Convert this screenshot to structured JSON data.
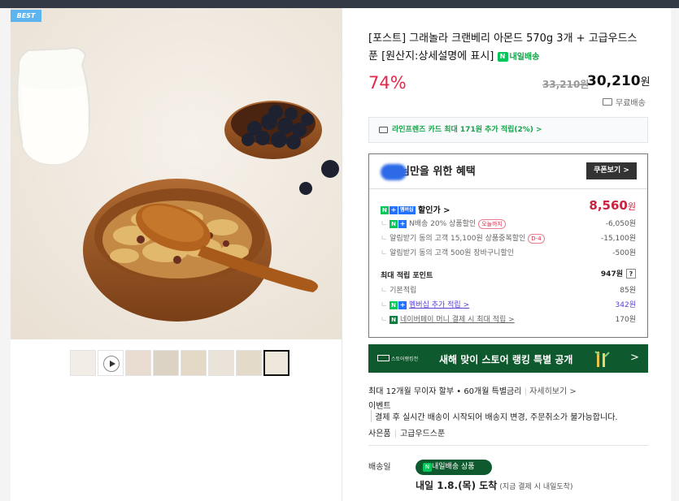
{
  "gallery": {
    "badge": "BEST",
    "thumb_count": 8
  },
  "product": {
    "title": "[포스트] 그래놀라 크랜베리 아몬드 570g 3개 + 고급우드스푼 [원산지:상세설명에 표시]",
    "nextday_label": "내일배송",
    "discount": "74%",
    "original_price": "33,210원",
    "price": "30,210",
    "price_unit": "원",
    "shipping": "무료배송",
    "card_benefit": "라인프렌즈 카드 최대 171원 추가 적립(2%) >"
  },
  "benefit": {
    "title": "님만을 위한 혜택",
    "coupon_button": "쿠폰보기 >",
    "discount_label": "할인가 >",
    "discount_price": "8,560",
    "discount_unit": "원",
    "items": [
      {
        "label": "N배송 20% 상품할인",
        "tag": "오늘까지",
        "amount": "-6,050원"
      },
      {
        "label": "알림받기 동의 고객 15,100원 상품중복할인",
        "tag": "D-4",
        "amount": "-15,100원"
      },
      {
        "label": "알림받기 동의 고객 500원 장바구니할인",
        "tag": "",
        "amount": "-500원"
      }
    ],
    "points_label": "최대 적립 포인트",
    "points_total": "947원",
    "points_help": "?",
    "points": [
      {
        "label": "기본적립",
        "amount": "85원"
      },
      {
        "label": "멤버십 추가 적립 >",
        "amount": "342원"
      },
      {
        "label": "네이버페이 머니 결제 시 최대 적립 >",
        "amount": "170원"
      }
    ]
  },
  "banner": {
    "small": "스토어랭킹전",
    "main": "새해 맞이 스토어 랭킹 특별 공개",
    "arrow": ">"
  },
  "install": {
    "text": "최대 12개월 무이자 할부 • 60개월 특별금리",
    "more": "자세히보기 >"
  },
  "event": {
    "label": "이벤트",
    "text": "결제 후 실시간 배송이 시작되어 배송지 변경, 주문취소가 불가능합니다."
  },
  "gift": {
    "label": "사은품",
    "value": "고급우드스푼"
  },
  "delivery": {
    "label": "배송일",
    "badge": "내일배송 상품",
    "arrive": "내일 1.8.(목) 도착",
    "note": "(지금 결제 시 내일도착)"
  },
  "colors": {
    "accent_red": "#e4284a",
    "naver_green": "#03c75a",
    "banner_green": "#0e5a2e"
  }
}
